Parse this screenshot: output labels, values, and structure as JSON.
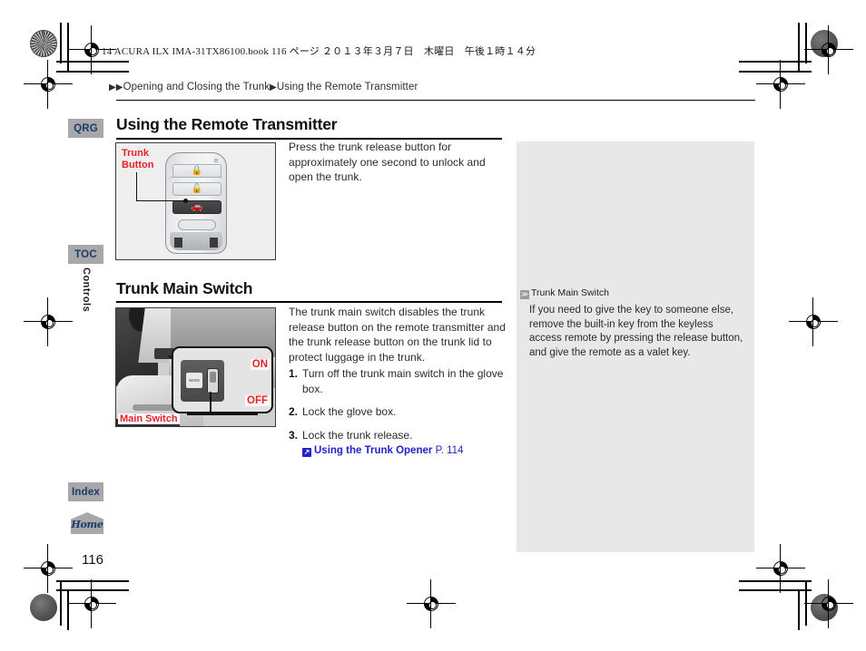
{
  "book_header": "14 ACURA ILX IMA-31TX86100.book  116 ページ  ２０１３年３月７日　木曜日　午後１時１４分",
  "breadcrumb": {
    "arrow_double": "▶▶",
    "arrow_single": "▶",
    "level1": "Opening and Closing the Trunk",
    "level2": "Using the Remote Transmitter"
  },
  "sidebar": {
    "items": [
      {
        "id": "qrg",
        "label": "QRG"
      },
      {
        "id": "toc",
        "label": "TOC"
      },
      {
        "id": "index",
        "label": "Index"
      },
      {
        "id": "home",
        "label": "Home"
      }
    ],
    "section_label": "Controls"
  },
  "sections": [
    {
      "id": "remote-transmitter",
      "heading": "Using the Remote Transmitter",
      "body": "Press the trunk release button for approximately one second to unlock and open the trunk.",
      "figure": {
        "name": "remote-key-fob",
        "callout": "Trunk\nButton",
        "callout_line1": "Trunk",
        "callout_line2": "Button",
        "buttons": [
          {
            "name": "lock-button",
            "glyph": "🔒"
          },
          {
            "name": "unlock-button",
            "glyph": "🔓"
          },
          {
            "name": "trunk-release-button",
            "glyph": "🚗"
          }
        ]
      }
    },
    {
      "id": "trunk-main-switch",
      "heading": "Trunk Main Switch",
      "body": "The trunk main switch disables the trunk release button on the remote transmitter and the trunk release button on the trunk lid to protect luggage in the trunk.",
      "figure": {
        "name": "trunk-main-switch-photo",
        "label_main_switch": "Main Switch",
        "label_on": "ON",
        "label_off": "OFF",
        "switch_icon_text": "MAIN"
      },
      "steps": [
        {
          "num": "1.",
          "text": "Turn off the trunk main switch in the glove box."
        },
        {
          "num": "2.",
          "text": "Lock the glove box."
        },
        {
          "num": "3.",
          "text": "Lock the trunk release."
        }
      ],
      "cross_reference": {
        "icon": "↗",
        "title": "Using the Trunk Opener",
        "page": "P. 114"
      }
    }
  ],
  "note_panel": {
    "icon": "≫",
    "title": "Trunk Main Switch",
    "body": "If you need to give the key to someone else, remove the built-in key from the keyless access remote by pressing the release button, and give the remote as a valet key."
  },
  "page_number": "116",
  "colors": {
    "tab_background": "#a8a8a8",
    "tab_text": "#1b3a6b",
    "callout_red": "#ee1c25",
    "link_blue": "#2222cc",
    "note_panel_background": "#e8e8e8"
  }
}
